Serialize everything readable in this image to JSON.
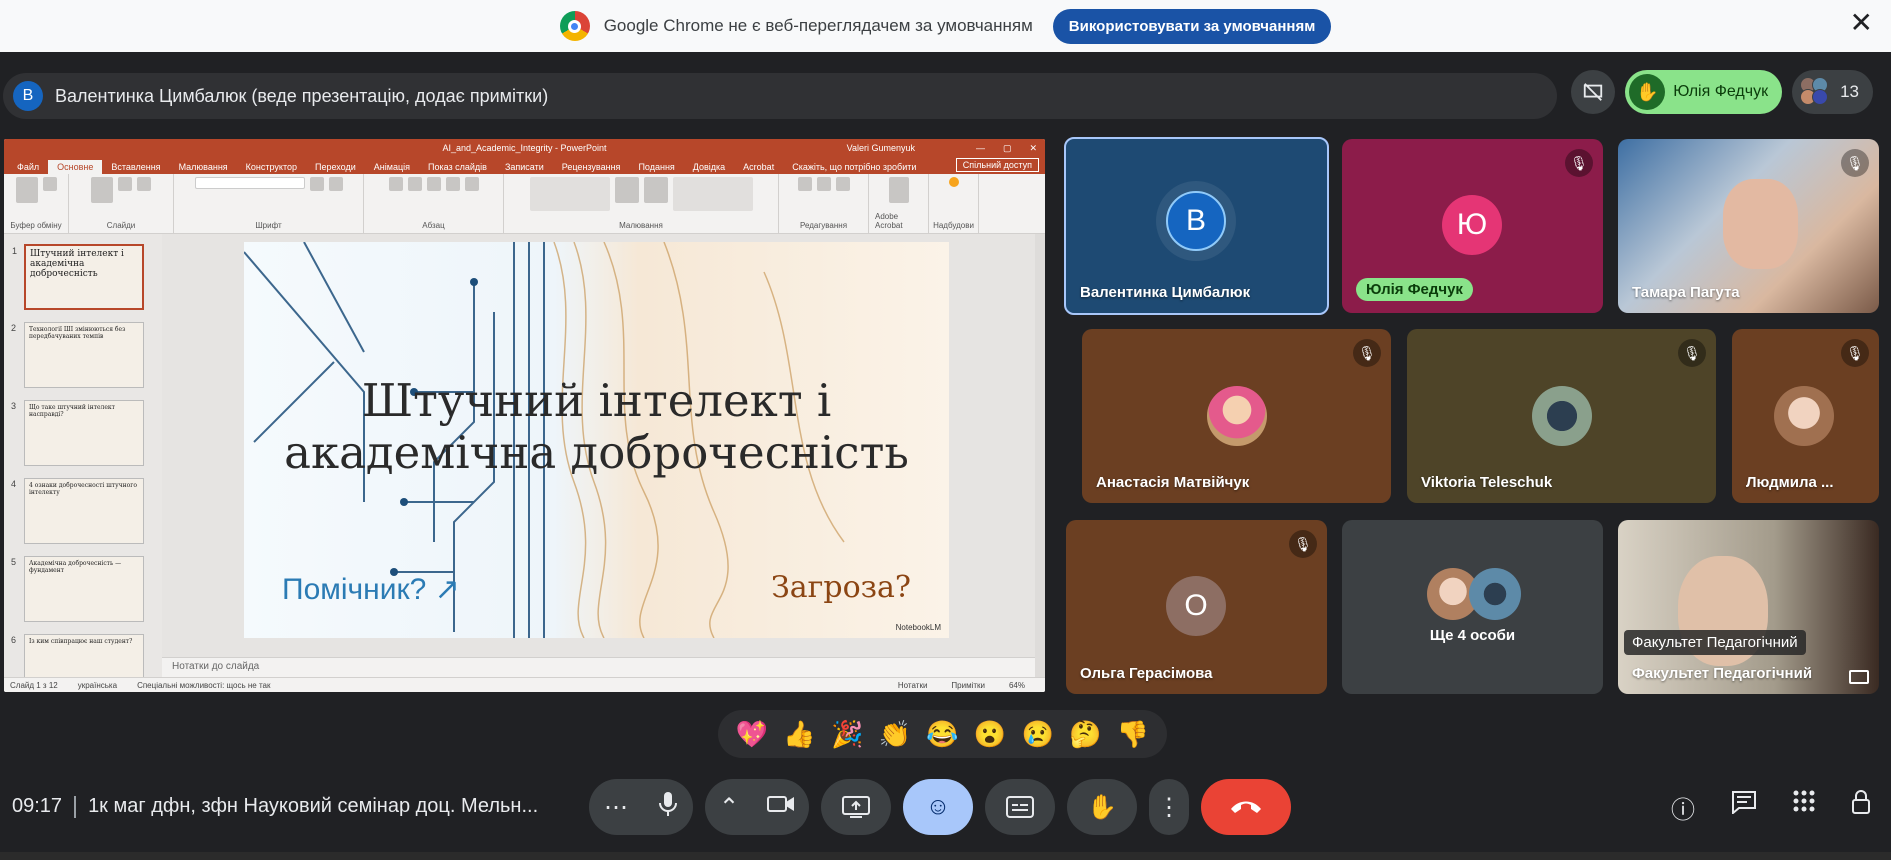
{
  "infobar": {
    "message": "Google Chrome не є веб-переглядачем за умовчанням",
    "default_button": "Використовувати за умовчанням",
    "close": "✕"
  },
  "presenter": {
    "avatar_letter": "В",
    "text": "Валентинка Цимбалюк (веде презентацію, додає примітки)"
  },
  "top_right": {
    "speaker_name": "Юлія Федчук",
    "participants_count": "13"
  },
  "ppt": {
    "window_title": "AI_and_Academic_Integrity - PowerPoint",
    "user": "Valeri Gumenyuk",
    "tabs": [
      "Файл",
      "Основне",
      "Вставлення",
      "Малювання",
      "Конструктор",
      "Переходи",
      "Анімація",
      "Показ слайдів",
      "Записати",
      "Рецензування",
      "Подання",
      "Довідка",
      "Acrobat",
      "Скажіть, що потрібно зробити"
    ],
    "share": "Спільний доступ",
    "groups": [
      "Буфер обміну",
      "Слайди",
      "Шрифт",
      "Абзац",
      "Малювання",
      "Редагування",
      "Adobe Acrobat",
      "Надбудови"
    ],
    "thumbnails": [
      {
        "num": "1",
        "text": "Штучний інтелект і академічна доброчесність"
      },
      {
        "num": "2",
        "text": "Технології ШІ змінюються без передбачуваних темпів"
      },
      {
        "num": "3",
        "text": "Що таке штучний інтелект насправді?"
      },
      {
        "num": "4",
        "text": "4 ознаки доброчесності штучного інтелекту"
      },
      {
        "num": "5",
        "text": "Академічна доброчесність — фундамент"
      },
      {
        "num": "6",
        "text": "Із ким співпрацює наш студент?"
      }
    ],
    "slide": {
      "title_line1": "Штучний інтелект і",
      "title_line2": "академічна доброчесність",
      "helper": "Помічник? ↗",
      "threat": "Загроза?",
      "brand": "NotebookLM"
    },
    "notes": "Нотатки до слайда",
    "status": {
      "slide_of": "Слайд 1 з 12",
      "language": "українська",
      "accessibility": "Спеціальні можливості: щось не так",
      "notes_btn": "Нотатки",
      "comments_btn": "Примітки",
      "zoom": "64%"
    }
  },
  "tiles": [
    {
      "name": "Валентинка Цимбалюк",
      "letter": "В"
    },
    {
      "name": "Юлія Федчук",
      "letter": "Ю"
    },
    {
      "name": "Тамара Пагута"
    },
    {
      "name": "Анастасія Матвійчук"
    },
    {
      "name": "Viktoria Teleschuk"
    },
    {
      "name": "Людмила ..."
    },
    {
      "name": "Ольга Герасімова",
      "letter": "О"
    },
    {
      "name": "Ще 4 особи"
    },
    {
      "name": "Факультет Педагогічний",
      "overlay": "Факультет Педагогічний"
    }
  ],
  "reactions": [
    "💖",
    "👍",
    "🎉",
    "👏",
    "😂",
    "😮",
    "😢",
    "🤔",
    "👎"
  ],
  "meeting": {
    "time": "09:17",
    "title": "1к маг дфн, зфн Науковий семінар доц. Мельн..."
  }
}
